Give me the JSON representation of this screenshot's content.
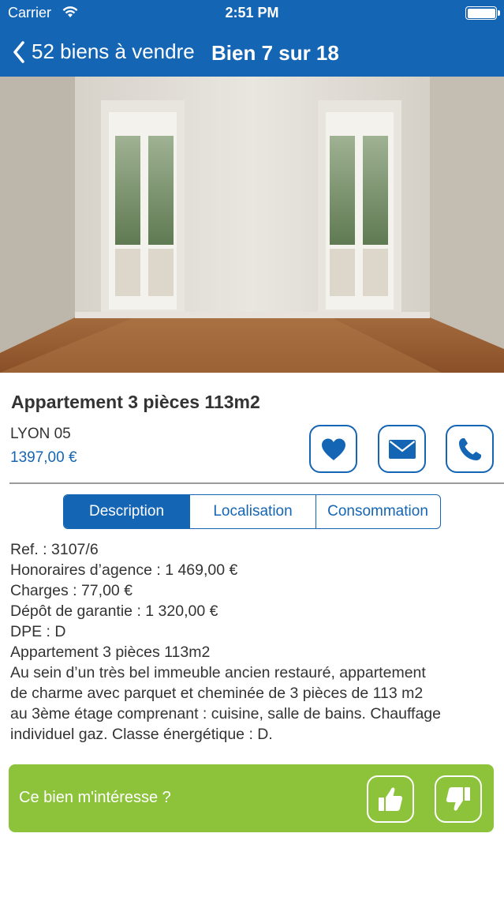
{
  "status_bar": {
    "carrier": "Carrier",
    "time": "2:51 PM"
  },
  "nav": {
    "back_label": "52 biens à vendre",
    "title": "Bien 7 sur 18"
  },
  "listing": {
    "title": "Appartement 3 pièces 113m2",
    "city": "LYON 05",
    "price": "1397,00 €"
  },
  "actions": {
    "favorite_icon": "heart-icon",
    "email_icon": "envelope-icon",
    "call_icon": "phone-icon"
  },
  "tabs": [
    {
      "label": "Description",
      "active": true
    },
    {
      "label": "Localisation",
      "active": false
    },
    {
      "label": "Consommation",
      "active": false
    }
  ],
  "description": {
    "lines": [
      "Ref. : 3107/6",
      "Honoraires d’agence : 1 469,00 €",
      "Charges : 77,00 €",
      "Dépôt de garantie : 1 320,00 €",
      "DPE : D",
      "Appartement 3 pièces 113m2",
      "Au sein d’un très bel immeuble ancien restauré, appartement",
      "de charme avec parquet et cheminée de 3 pièces de 113 m2",
      "au 3ème étage comprenant : cuisine, salle de bains. Chauffage",
      "individuel gaz. Classe énergétique : D."
    ]
  },
  "interest": {
    "label": "Ce bien m'intéresse ?",
    "like_icon": "thumbs-up-icon",
    "dislike_icon": "thumbs-down-icon"
  },
  "colors": {
    "brand": "#1565b5",
    "cta": "#8dc33a",
    "text": "#333333"
  }
}
